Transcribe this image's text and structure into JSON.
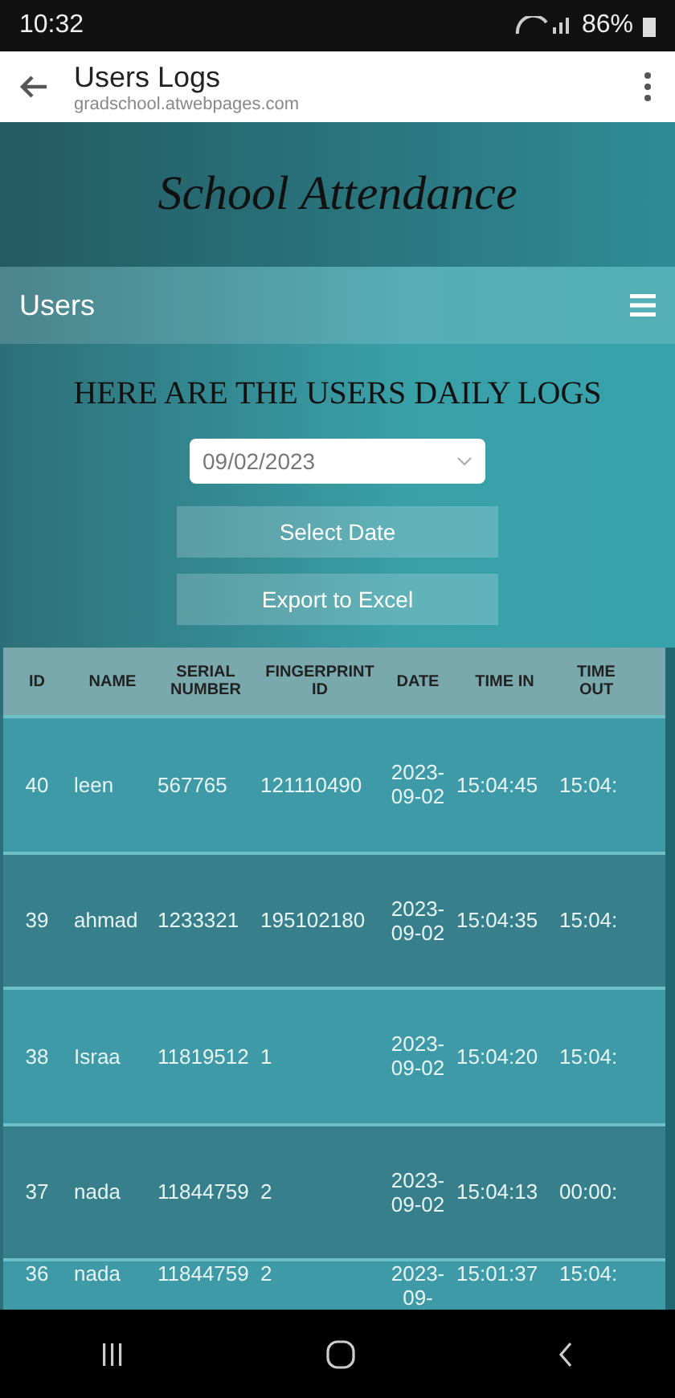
{
  "status_bar": {
    "time": "10:32",
    "battery": "86%"
  },
  "browser": {
    "title": "Users Logs",
    "url": "gradschool.atwebpages.com"
  },
  "site_title": "School Attendance",
  "nav": {
    "label": "Users"
  },
  "heading": "HERE ARE THE USERS DAILY LOGS",
  "date_select": {
    "value": "09/02/2023"
  },
  "buttons": [
    "Select Date",
    "Export to Excel"
  ],
  "table": {
    "columns": [
      "ID",
      "NAME",
      "SERIAL NUMBER",
      "FINGERPRINT ID",
      "DATE",
      "TIME IN",
      "TIME OUT"
    ],
    "rows": [
      [
        "40",
        "leen",
        "567765",
        "121110490",
        "2023-09-02",
        "15:04:45",
        "15:04:"
      ],
      [
        "39",
        "ahmad",
        "1233321",
        "195102180",
        "2023-09-02",
        "15:04:35",
        "15:04:"
      ],
      [
        "38",
        "Israa",
        "11819512",
        "1",
        "2023-09-02",
        "15:04:20",
        "15:04:"
      ],
      [
        "37",
        "nada",
        "11844759",
        "2",
        "2023-09-02",
        "15:04:13",
        "00:00:"
      ],
      [
        "36",
        "nada",
        "11844759",
        "2",
        "2023-09-",
        "15:01:37",
        "15:04:"
      ]
    ]
  }
}
